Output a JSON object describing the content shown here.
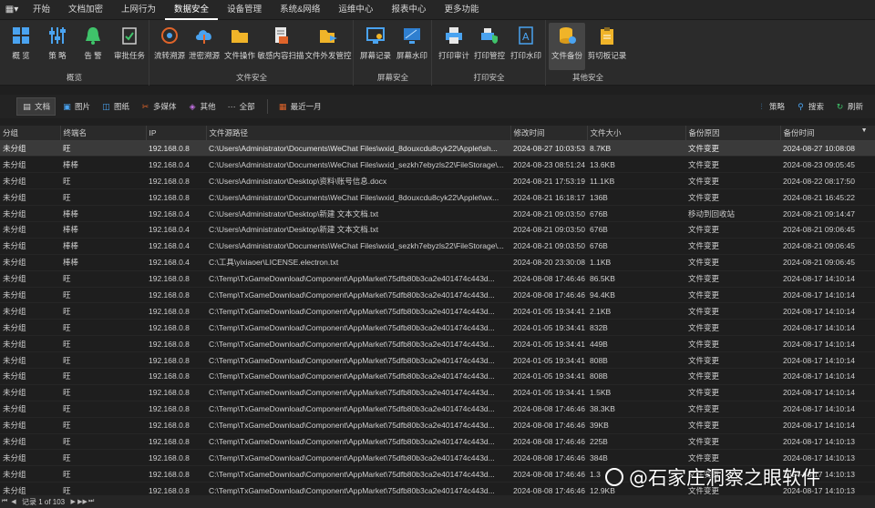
{
  "menu": {
    "app_icon": "app-menu-icon",
    "tabs": [
      "开始",
      "文档加密",
      "上网行为",
      "数据安全",
      "设备管理",
      "系统&网络",
      "运维中心",
      "报表中心",
      "更多功能"
    ],
    "active_tab": "数据安全"
  },
  "ribbon": {
    "groups": [
      {
        "label": "概览",
        "buttons": [
          "概 览",
          "策 略",
          "告 警",
          "审批任务"
        ]
      },
      {
        "label": "文件安全",
        "buttons": [
          "流转溯源",
          "泄密溯源",
          "文件操作",
          "敏感内容扫描",
          "文件外发管控"
        ]
      },
      {
        "label": "屏幕安全",
        "buttons": [
          "屏幕记录",
          "屏幕水印"
        ]
      },
      {
        "label": "打印安全",
        "buttons": [
          "打印审计",
          "打印管控",
          "打印水印"
        ]
      },
      {
        "label": "其他安全",
        "buttons": [
          "文件备份",
          "剪切板记录"
        ]
      }
    ],
    "active_button": "文件备份"
  },
  "filters": {
    "types": [
      "文档",
      "图片",
      "图纸",
      "多媒体",
      "其他",
      "全部"
    ],
    "active_type": "文档",
    "time_range": "最近一月",
    "right_buttons": [
      "策略",
      "搜索",
      "刷新"
    ]
  },
  "table": {
    "columns": [
      "分组",
      "终端名",
      "IP",
      "文件源路径",
      "修改时间",
      "文件大小",
      "备份原因",
      "备份时间"
    ],
    "rows": [
      [
        "未分组",
        "旺",
        "192.168.0.8",
        "C:\\Users\\Administrator\\Documents\\WeChat Files\\wxid_8douxcdu8cyk22\\Applet\\sh...",
        "2024-08-27 10:03:53",
        "8.7KB",
        "文件变更",
        "2024-08-27 10:08:08"
      ],
      [
        "未分组",
        "棒棒",
        "192.168.0.4",
        "C:\\Users\\Administrator\\Documents\\WeChat Files\\wxid_sezkh7ebyzls22\\FileStorage\\...",
        "2024-08-23 08:51:24",
        "13.6KB",
        "文件变更",
        "2024-08-23 09:05:45"
      ],
      [
        "未分组",
        "旺",
        "192.168.0.8",
        "C:\\Users\\Administrator\\Desktop\\资料\\账号信息.docx",
        "2024-08-21 17:53:19",
        "11.1KB",
        "文件变更",
        "2024-08-22 08:17:50"
      ],
      [
        "未分组",
        "旺",
        "192.168.0.8",
        "C:\\Users\\Administrator\\Documents\\WeChat Files\\wxid_8douxcdu8cyk22\\Applet\\wx...",
        "2024-08-21 16:18:17",
        "136B",
        "文件变更",
        "2024-08-21 16:45:22"
      ],
      [
        "未分组",
        "棒棒",
        "192.168.0.4",
        "C:\\Users\\Administrator\\Desktop\\新建 文本文档.txt",
        "2024-08-21 09:03:50",
        "676B",
        "移动到回收站",
        "2024-08-21 09:14:47"
      ],
      [
        "未分组",
        "棒棒",
        "192.168.0.4",
        "C:\\Users\\Administrator\\Desktop\\新建 文本文档.txt",
        "2024-08-21 09:03:50",
        "676B",
        "文件变更",
        "2024-08-21 09:06:45"
      ],
      [
        "未分组",
        "棒棒",
        "192.168.0.4",
        "C:\\Users\\Administrator\\Documents\\WeChat Files\\wxid_sezkh7ebyzls22\\FileStorage\\...",
        "2024-08-21 09:03:50",
        "676B",
        "文件变更",
        "2024-08-21 09:06:45"
      ],
      [
        "未分组",
        "棒棒",
        "192.168.0.4",
        "C:\\工具\\yixiaoer\\LICENSE.electron.txt",
        "2024-08-20 23:30:08",
        "1.1KB",
        "文件变更",
        "2024-08-21 09:06:45"
      ],
      [
        "未分组",
        "旺",
        "192.168.0.8",
        "C:\\Temp\\TxGameDownload\\Component\\AppMarket\\75dfb80b3ca2e401474c443d...",
        "2024-08-08 17:46:46",
        "86.5KB",
        "文件变更",
        "2024-08-17 14:10:14"
      ],
      [
        "未分组",
        "旺",
        "192.168.0.8",
        "C:\\Temp\\TxGameDownload\\Component\\AppMarket\\75dfb80b3ca2e401474c443d...",
        "2024-08-08 17:46:46",
        "94.4KB",
        "文件变更",
        "2024-08-17 14:10:14"
      ],
      [
        "未分组",
        "旺",
        "192.168.0.8",
        "C:\\Temp\\TxGameDownload\\Component\\AppMarket\\75dfb80b3ca2e401474c443d...",
        "2024-01-05 19:34:41",
        "2.1KB",
        "文件变更",
        "2024-08-17 14:10:14"
      ],
      [
        "未分组",
        "旺",
        "192.168.0.8",
        "C:\\Temp\\TxGameDownload\\Component\\AppMarket\\75dfb80b3ca2e401474c443d...",
        "2024-01-05 19:34:41",
        "832B",
        "文件变更",
        "2024-08-17 14:10:14"
      ],
      [
        "未分组",
        "旺",
        "192.168.0.8",
        "C:\\Temp\\TxGameDownload\\Component\\AppMarket\\75dfb80b3ca2e401474c443d...",
        "2024-01-05 19:34:41",
        "449B",
        "文件变更",
        "2024-08-17 14:10:14"
      ],
      [
        "未分组",
        "旺",
        "192.168.0.8",
        "C:\\Temp\\TxGameDownload\\Component\\AppMarket\\75dfb80b3ca2e401474c443d...",
        "2024-01-05 19:34:41",
        "808B",
        "文件变更",
        "2024-08-17 14:10:14"
      ],
      [
        "未分组",
        "旺",
        "192.168.0.8",
        "C:\\Temp\\TxGameDownload\\Component\\AppMarket\\75dfb80b3ca2e401474c443d...",
        "2024-01-05 19:34:41",
        "808B",
        "文件变更",
        "2024-08-17 14:10:14"
      ],
      [
        "未分组",
        "旺",
        "192.168.0.8",
        "C:\\Temp\\TxGameDownload\\Component\\AppMarket\\75dfb80b3ca2e401474c443d...",
        "2024-01-05 19:34:41",
        "1.5KB",
        "文件变更",
        "2024-08-17 14:10:14"
      ],
      [
        "未分组",
        "旺",
        "192.168.0.8",
        "C:\\Temp\\TxGameDownload\\Component\\AppMarket\\75dfb80b3ca2e401474c443d...",
        "2024-08-08 17:46:46",
        "38.3KB",
        "文件变更",
        "2024-08-17 14:10:14"
      ],
      [
        "未分组",
        "旺",
        "192.168.0.8",
        "C:\\Temp\\TxGameDownload\\Component\\AppMarket\\75dfb80b3ca2e401474c443d...",
        "2024-08-08 17:46:46",
        "39KB",
        "文件变更",
        "2024-08-17 14:10:14"
      ],
      [
        "未分组",
        "旺",
        "192.168.0.8",
        "C:\\Temp\\TxGameDownload\\Component\\AppMarket\\75dfb80b3ca2e401474c443d...",
        "2024-08-08 17:46:46",
        "225B",
        "文件变更",
        "2024-08-17 14:10:13"
      ],
      [
        "未分组",
        "旺",
        "192.168.0.8",
        "C:\\Temp\\TxGameDownload\\Component\\AppMarket\\75dfb80b3ca2e401474c443d...",
        "2024-08-08 17:46:46",
        "384B",
        "文件变更",
        "2024-08-17 14:10:13"
      ],
      [
        "未分组",
        "旺",
        "192.168.0.8",
        "C:\\Temp\\TxGameDownload\\Component\\AppMarket\\75dfb80b3ca2e401474c443d...",
        "2024-08-08 17:46:46",
        "1.3",
        "文件变更",
        "2024-08-17 14:10:13"
      ],
      [
        "未分组",
        "旺",
        "192.168.0.8",
        "C:\\Temp\\TxGameDownload\\Component\\AppMarket\\75dfb80b3ca2e401474c443d...",
        "2024-08-08 17:46:46",
        "12.9KB",
        "文件变更",
        "2024-08-17 14:10:13"
      ]
    ],
    "selected_row": 0
  },
  "status": {
    "records": "记录 1 of 103"
  },
  "watermark": "@石家庄洞察之眼软件"
}
